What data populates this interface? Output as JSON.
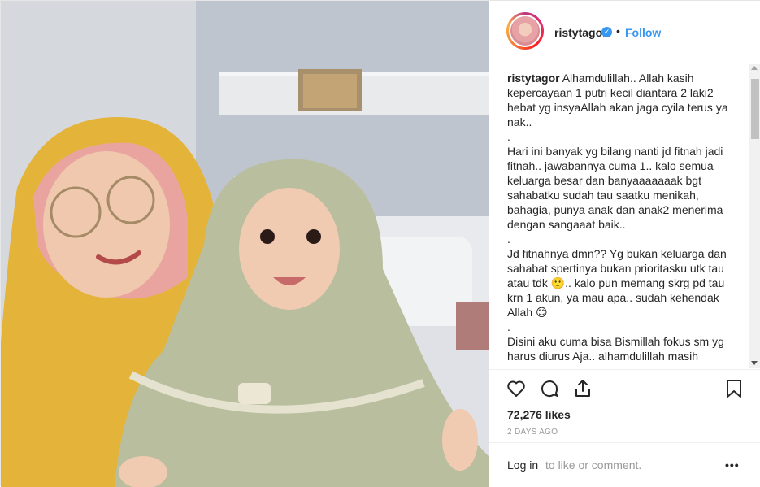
{
  "header": {
    "username": "ristytagor",
    "verified_icon": "verified-badge-icon",
    "separator": "•",
    "follow_label": "Follow"
  },
  "caption": {
    "username": "ristytagor",
    "text": " Alhamdulillah.. Allah kasih kepercayaan 1 putri kecil diantara 2 laki2 hebat yg insyaAllah akan jaga cyila terus ya nak..\n.\nHari ini banyak yg bilang nanti jd fitnah jadi fitnah.. jawabannya cuma 1.. kalo semua keluarga besar dan banyaaaaaaak bgt sahabatku sudah tau saatku menikah, bahagia, punya anak dan anak2 menerima dengan sangaaat baik..\n.\nJd fitnahnya dmn?? Yg bukan keluarga dan sahabat spertinya bukan prioritasku utk tau atau tdk 🙂.. kalo pun memang skrg pd tau krn 1 akun, ya mau apa.. sudah kehendak Allah 😊\n.\nDisini aku cuma bisa Bismillah fokus sm yg harus diurus Aja.. alhamdulillah masih"
  },
  "actions": {
    "icons": [
      "heart-icon",
      "comment-icon",
      "share-icon",
      "bookmark-icon"
    ],
    "likes": "72,276 likes",
    "time_ago": "2 DAYS AGO"
  },
  "footer": {
    "login_link": "Log in",
    "login_rest": "to like or comment.",
    "more_label": "•••"
  },
  "colors": {
    "accent": "#3897f0",
    "text": "#262626",
    "muted": "#999999",
    "border": "#efefef"
  }
}
